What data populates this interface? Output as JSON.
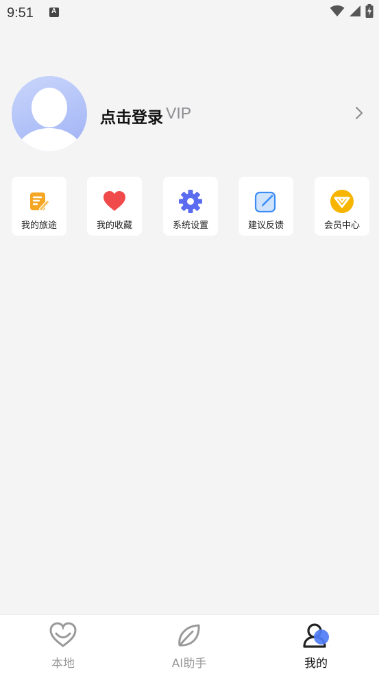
{
  "status_bar": {
    "time": "9:51",
    "icons": [
      "keyboard-a-icon",
      "wifi-icon",
      "signal-icon",
      "battery-charging-icon"
    ]
  },
  "profile": {
    "login_label": "点击登录",
    "vip_label": "VIP",
    "avatar_icon": "user-avatar-icon",
    "arrow_icon": "chevron-right-icon",
    "avatar_gradient": [
      "#c9d6fb",
      "#9fb2f5"
    ]
  },
  "shortcuts": [
    {
      "label": "我的旅途",
      "icon": "journey-note-icon",
      "color": "#f5a623"
    },
    {
      "label": "我的收藏",
      "icon": "heart-icon",
      "color": "#f04a4a"
    },
    {
      "label": "系统设置",
      "icon": "gear-icon",
      "color": "#5b6cf0"
    },
    {
      "label": "建议反馈",
      "icon": "edit-feedback-icon",
      "color": "#3b8cf5"
    },
    {
      "label": "会员中心",
      "icon": "vip-diamond-icon",
      "color": "#f7b500"
    }
  ],
  "bottom_nav": [
    {
      "label": "本地",
      "icon": "heart-outline-icon",
      "active": false
    },
    {
      "label": "AI助手",
      "icon": "leaf-icon",
      "active": false
    },
    {
      "label": "我的",
      "icon": "profile-icon",
      "active": true
    }
  ],
  "colors": {
    "background": "#f4f4f5",
    "accent": "#4f7df5"
  }
}
